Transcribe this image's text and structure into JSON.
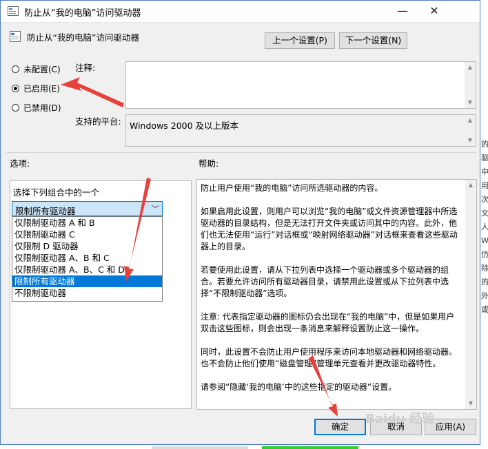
{
  "window": {
    "title": "防止从“我的电脑”访问驱动器",
    "minimize_symbol": "—",
    "close_symbol": "✕"
  },
  "policy": {
    "name": "防止从“我的电脑”访问驱动器"
  },
  "nav": {
    "prev_label": "上一个设置(P)",
    "next_label": "下一个设置(N)"
  },
  "state": {
    "options": [
      {
        "label": "未配置(C)",
        "selected": false
      },
      {
        "label": "已启用(E)",
        "selected": true
      },
      {
        "label": "已禁用(D)",
        "selected": false
      }
    ]
  },
  "comment": {
    "label": "注释:",
    "value": ""
  },
  "platform": {
    "label": "支持的平台:",
    "value": "Windows 2000 及以上版本"
  },
  "options_section": {
    "header": "选项:",
    "combo_label": "选择下列组合中的一个",
    "selected_value": "限制所有驱动器",
    "dropdown_items": [
      "仅限制驱动器 A 和 B",
      "仅限制驱动器 C",
      "仅限制 D 驱动器",
      "仅限制驱动器 A、B 和 C",
      "仅限制驱动器 A、B、C 和 D",
      "限制所有驱动器",
      "不限制驱动器"
    ],
    "highlighted_index": 5
  },
  "help_section": {
    "header": "帮助:",
    "paragraphs": [
      "防止用户使用“我的电脑”访问所选驱动器的内容。",
      "如果启用此设置，则用户可以浏览“我的电脑”或文件资源管理器中所选驱动器的目录结构，但是无法打开文件夹或访问其中的内容。此外，他们也无法使用“运行”对话框或“映射网络驱动器”对话框来查看这些驱动器上的目录。",
      "若要使用此设置，请从下拉列表中选择一个驱动器或多个驱动器的组合。若要允许访问所有驱动器目录，请禁用此设置或从下拉列表中选择“不限制驱动器”选项。",
      "注意: 代表指定驱动器的图标仍会出现在“我的电脑”中，但是如果用户双击这些图标，则会出现一条消息来解释设置防止这一操作。",
      " 同时，此设置不会防止用户使用程序来访问本地驱动器和网络驱动器。也不会防止他们使用“磁盘管理”管理单元查看并更改驱动器特性。",
      "请参阅“隐藏‘我的电脑’中的这些指定的驱动器”设置。"
    ]
  },
  "footer": {
    "ok_label": "确定",
    "cancel_label": "取消",
    "apply_label": "应用(A)"
  },
  "side_text": "的\n驱\n中\n用\n次\n文\n人\nW\n仿\n除\n的\n外\n或",
  "watermark": "Baidu 经验",
  "colors": {
    "accent": "#0078d7",
    "annotation_arrow": "#e8413c",
    "dialog_bg": "#f0f0f0"
  }
}
